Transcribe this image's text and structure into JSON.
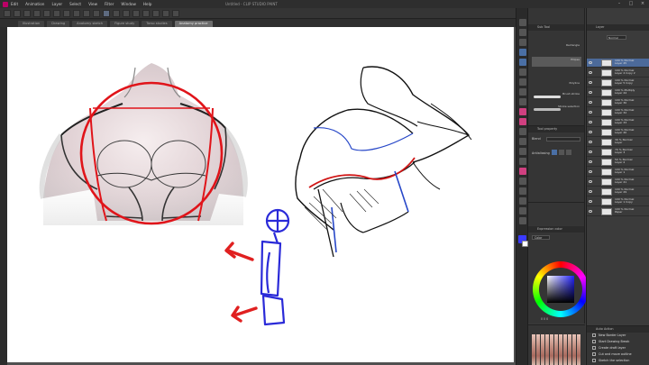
{
  "app": {
    "window_title": "Untitled - CLIP STUDIO PAINT",
    "menu": [
      "Edit",
      "Animation",
      "Layer",
      "Select",
      "View",
      "Filter",
      "Window",
      "Help"
    ]
  },
  "tabs": [
    {
      "label": "Illustration",
      "active": false
    },
    {
      "label": "Drawing",
      "active": false
    },
    {
      "label": "Anatomy sketch",
      "active": false
    },
    {
      "label": "Figure study",
      "active": false
    },
    {
      "label": "Torso studies",
      "active": false
    },
    {
      "label": "Anatomy practice",
      "active": true
    }
  ],
  "subtool": {
    "title": "Sub Tool",
    "brushes": [
      "Rectangle",
      "Ellipse",
      "Polyline",
      "Brush stroke",
      "Stroke selection"
    ]
  },
  "toolprop": {
    "title": "Tool property",
    "blend_label": "Blend",
    "antialiasing_label": "Antialiasing"
  },
  "color": {
    "title": "Expression color",
    "mode": "Color",
    "values": "0 0 0",
    "accent": "#3a3aff"
  },
  "layers": {
    "title": "Layer",
    "blend_mode": "Normal",
    "items": [
      {
        "text": "100 % Normal\nLayer 45",
        "selected": true
      },
      {
        "text": "100 % Normal\nLayer 4 Copy 2",
        "selected": false
      },
      {
        "text": "100 % Normal\nLayer 5 Copy",
        "selected": false
      },
      {
        "text": "100 % Multiply\nLayer 44",
        "selected": false
      },
      {
        "text": "100 % Normal\nLayer 30",
        "selected": false
      },
      {
        "text": "100 % Normal\nLayer 32",
        "selected": false
      },
      {
        "text": "100 % Normal\nLayer 33",
        "selected": false
      },
      {
        "text": "100 % Normal\nLayer 40",
        "selected": false
      },
      {
        "text": "39 % Normal\nLayer",
        "selected": false
      },
      {
        "text": "70 % Normal\nLayer 3",
        "selected": false
      },
      {
        "text": "50 % Normal\nLayer 2",
        "selected": false
      },
      {
        "text": "100 % Normal\nLayer 1",
        "selected": false
      },
      {
        "text": "100 % Normal\nLayer 41",
        "selected": false
      },
      {
        "text": "100 % Normal\nLayer 29",
        "selected": false
      },
      {
        "text": "100 % Normal\nLayer 1 Copy",
        "selected": false
      },
      {
        "text": "100 % Normal\nPaper",
        "selected": false
      }
    ]
  },
  "autoaction": {
    "title": "Auto Action",
    "items": [
      "New Border Layer",
      "Start Drawing Break",
      "Create draft layer",
      "Cut and move outline",
      "Sketch the selection"
    ]
  },
  "status": {
    "zoom": "24.3"
  }
}
